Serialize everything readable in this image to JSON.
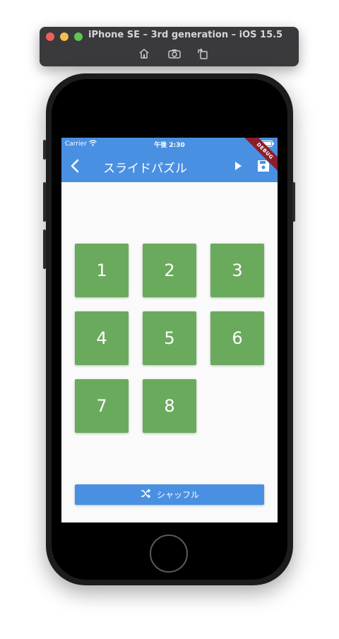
{
  "simulator": {
    "title": "iPhone SE – 3rd generation – iOS 15.5",
    "tools": [
      "home-icon",
      "screenshot-icon",
      "rotate-icon"
    ]
  },
  "status_bar": {
    "carrier": "Carrier",
    "time": "午後 2:30"
  },
  "app_bar": {
    "title": "スライドパズル",
    "debug_banner": "DEBUG",
    "color": "#4a90e2"
  },
  "puzzle": {
    "tiles": [
      "1",
      "2",
      "3",
      "4",
      "5",
      "6",
      "7",
      "8",
      ""
    ],
    "tile_color": "#6aaa5c"
  },
  "shuffle_button": {
    "label": "シャッフル",
    "icon": "shuffle-icon"
  }
}
